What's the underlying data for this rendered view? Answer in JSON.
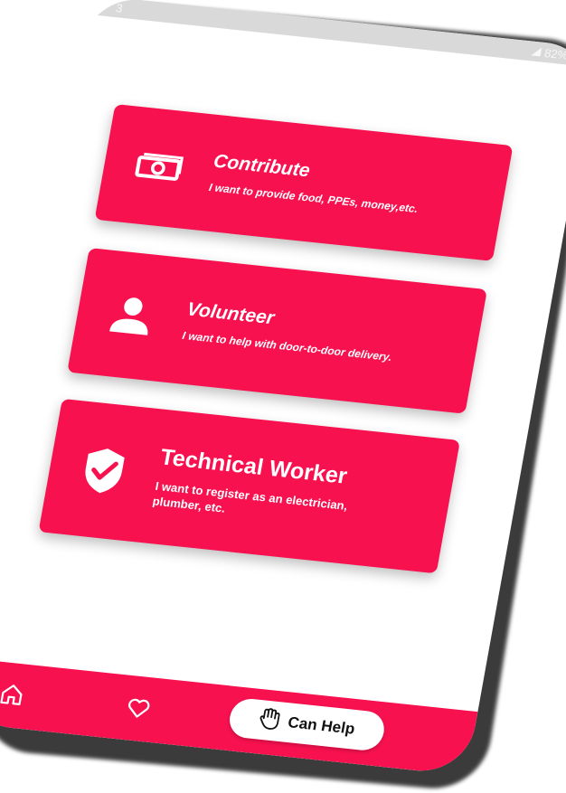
{
  "status_bar": {
    "left_text": "3",
    "right_text": "82%"
  },
  "cards": [
    {
      "icon": "money-icon",
      "title": "Contribute",
      "description": "I want to provide food, PPEs, money,etc."
    },
    {
      "icon": "person-icon",
      "title": "Volunteer",
      "description": "I want to help with door-to-door delivery."
    },
    {
      "icon": "shield-check-icon",
      "title": "Technical Worker",
      "description": "I want to register as an electrician, plumber, etc."
    }
  ],
  "bottom_nav": {
    "home_icon": "home-icon",
    "favorites_icon": "heart-icon",
    "active_label": "Can Help",
    "active_icon": "hand-icon"
  },
  "colors": {
    "accent": "#f8114f",
    "screen_bg": "#ffffff",
    "frame": "#1a1a1a"
  }
}
